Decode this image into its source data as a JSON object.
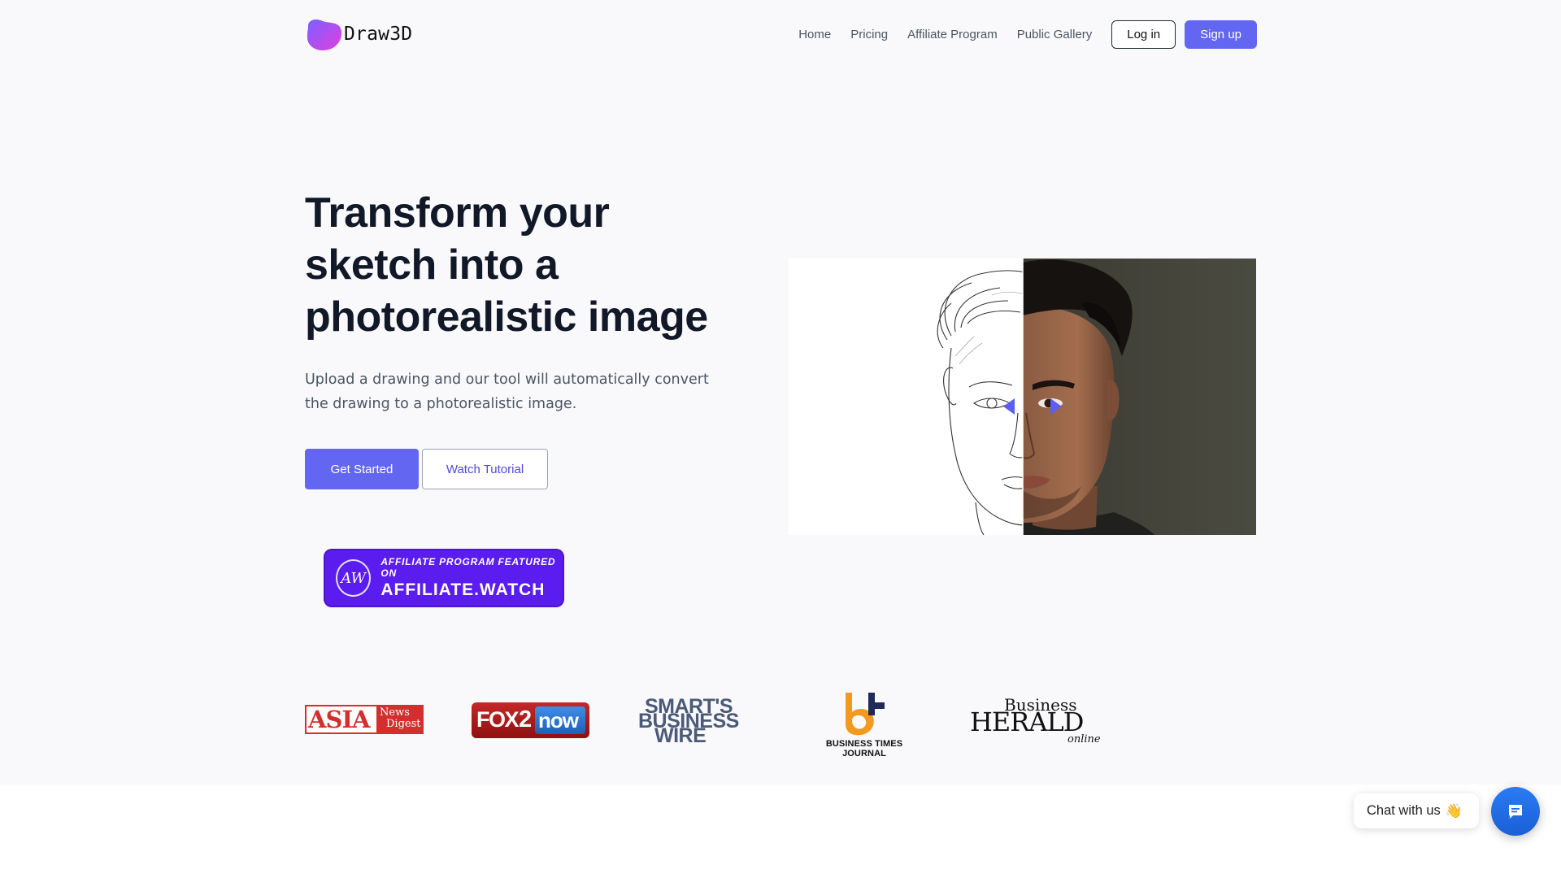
{
  "header": {
    "brand": "Draw3D",
    "nav": [
      {
        "label": "Home"
      },
      {
        "label": "Pricing"
      },
      {
        "label": "Affiliate Program"
      },
      {
        "label": "Public Gallery"
      }
    ],
    "login_label": "Log in",
    "signup_label": "Sign up"
  },
  "hero": {
    "title": "Transform your sketch into a photorealistic image",
    "subtitle": "Upload a drawing and our tool will automatically convert the drawing to a photorealistic image.",
    "primary_cta": "Get Started",
    "secondary_cta": "Watch Tutorial"
  },
  "affiliate_badge": {
    "line1": "AFFILIATE PROGRAM FEATURED ON",
    "line2": "AFFILIATE.WATCH",
    "logo_text": "AW"
  },
  "press": [
    {
      "name": "ASIA News Digest",
      "text1": "ASIA",
      "text2": "News",
      "text3": "Digest"
    },
    {
      "name": "FOX 2 now",
      "text1": "FOX",
      "text2": "2",
      "text3": "now"
    },
    {
      "name": "SMART'S BUSINESS WIRE",
      "text1": "SMART'S",
      "text2": "BUSINESS",
      "text3": "WIRE"
    },
    {
      "name": "BUSINESS TIMES JOURNAL",
      "text1": "BUSINESS TIMES JOURNAL"
    },
    {
      "name": "Business HERALD online",
      "text1": "Business",
      "text2": "HERALD",
      "text3": "online"
    }
  ],
  "chat": {
    "label": "Chat with us",
    "emoji": "👋"
  },
  "colors": {
    "accent": "#6366f1",
    "badge": "#5b1cf0",
    "chat": "#1a6fe8",
    "background": "#f9f9fc"
  },
  "icons": [
    "logo-blob-icon",
    "compare-left-arrow-icon",
    "compare-right-arrow-icon",
    "chat-bubble-icon",
    "wave-hand-icon"
  ]
}
